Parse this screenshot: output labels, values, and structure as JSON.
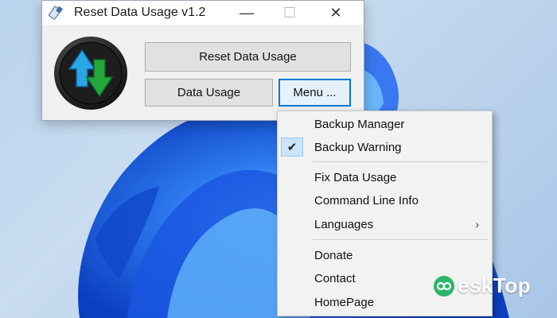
{
  "window": {
    "title": "Reset Data Usage v1.2",
    "minimize_glyph": "—",
    "maximize_glyph": "☐",
    "close_glyph": "✕"
  },
  "buttons": {
    "reset_label": "Reset Data Usage",
    "data_usage_label": "Data Usage",
    "menu_label": "Menu ..."
  },
  "menu": {
    "items": [
      {
        "label": "Backup Manager",
        "checked": false
      },
      {
        "label": "Backup Warning",
        "checked": true
      },
      {
        "label": "Fix Data Usage",
        "checked": false
      },
      {
        "label": "Command Line Info",
        "checked": false
      },
      {
        "label": "Languages",
        "checked": false,
        "submenu": true
      },
      {
        "label": "Donate",
        "checked": false
      },
      {
        "label": "Contact",
        "checked": false
      },
      {
        "label": "HomePage",
        "checked": false
      }
    ],
    "check_glyph": "✔",
    "submenu_glyph": "›"
  },
  "watermark": {
    "text": "esk"
  },
  "watermark_tail": {
    "text": "Top"
  },
  "colors": {
    "accent": "#0078d7",
    "wallpaper_blue": "#1f5fe0",
    "logo_green": "#22a83a",
    "logo_blue": "#2aa6e6"
  },
  "icons": [
    "eraser-icon",
    "app-logo-icon",
    "checkmark-icon",
    "chevron-right-icon",
    "desktop-logo-icon"
  ]
}
